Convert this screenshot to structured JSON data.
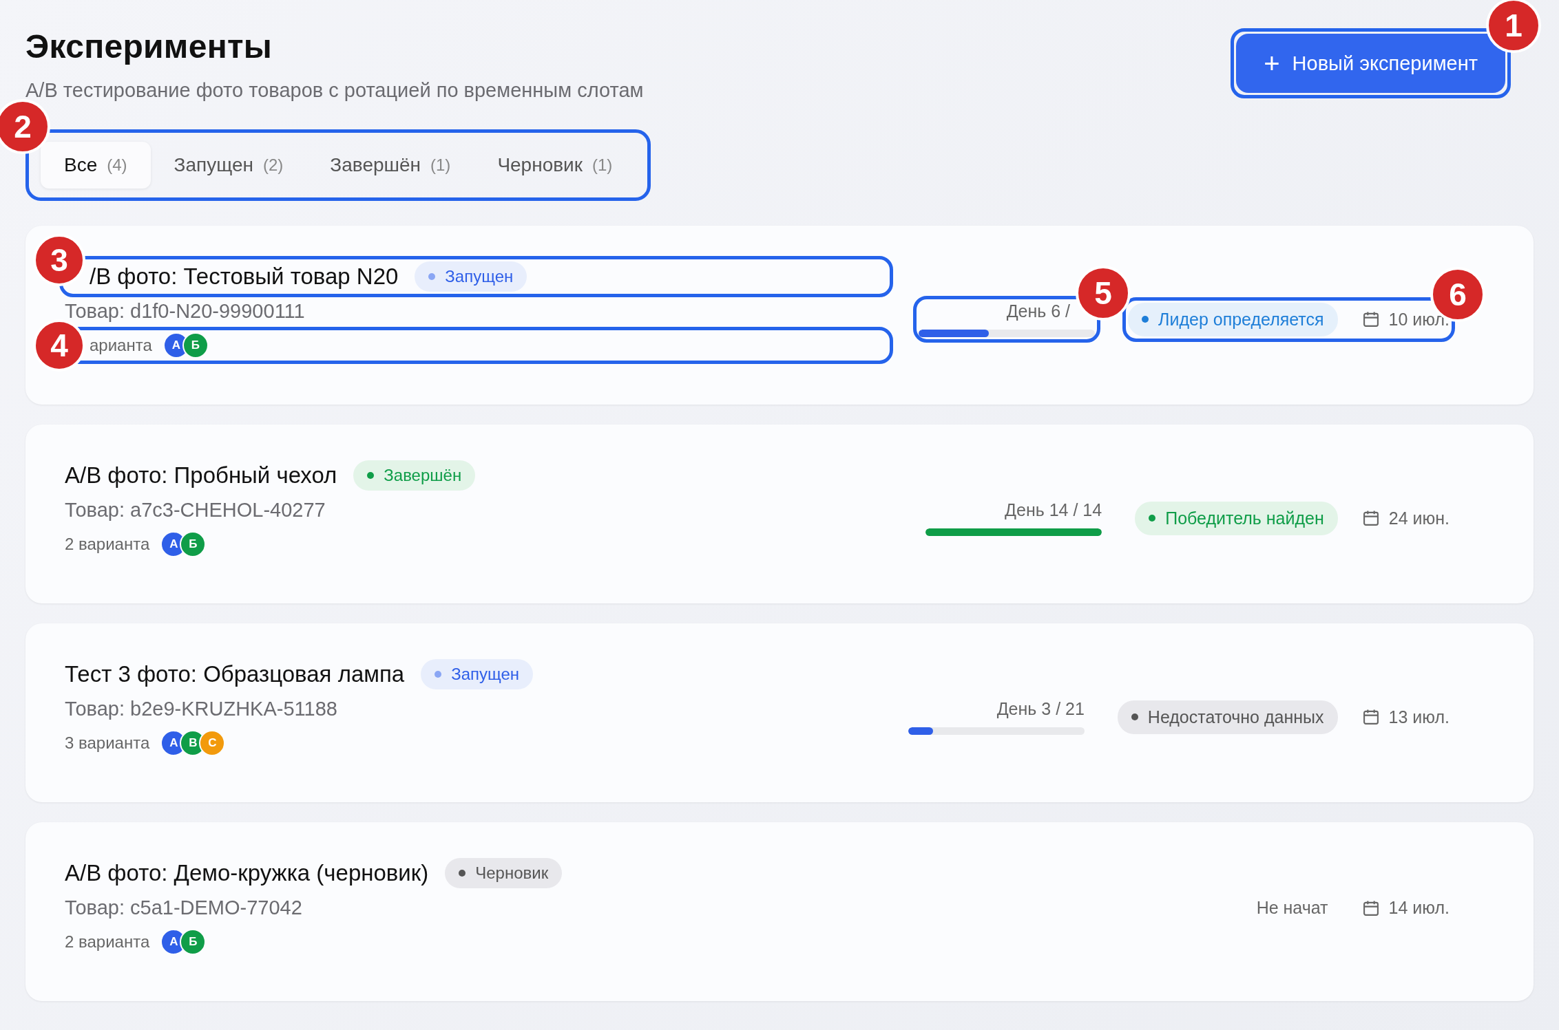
{
  "header": {
    "title": "Эксперименты",
    "subtitle": "A/B тестирование фото товаров с ротацией по временным слотам",
    "new_button": {
      "icon": "+",
      "label": "Новый эксперимент",
      "marker": "1"
    }
  },
  "tabs_marker": "2",
  "tabs": [
    {
      "label": "Все",
      "count": "(4)",
      "selected": true
    },
    {
      "label": "Запущен",
      "count": "(2)",
      "selected": false
    },
    {
      "label": "Завершён",
      "count": "(1)",
      "selected": false
    },
    {
      "label": "Черновик",
      "count": "(1)",
      "selected": false
    }
  ],
  "experiments": [
    {
      "title": "/B фото: Тестовый товар N20",
      "title_marker": "3",
      "status": {
        "kind": "running",
        "label": "Запущен"
      },
      "product": "Товар: d1f0-N20-99900111",
      "variants_label": "арианта",
      "variants_marker": "4",
      "variants": [
        {
          "letter": "А",
          "color": "#2f5fe8"
        },
        {
          "letter": "Б",
          "color": "#0f9d48"
        }
      ],
      "progress": {
        "kind": "bar",
        "day": "День 6 /",
        "level": 0.4,
        "color": "#2f5fe8"
      },
      "progress_marker": "5",
      "result": {
        "kind": "leader",
        "label": "Лидер определяется"
      },
      "result_marker": "6",
      "date": "10 июл."
    },
    {
      "title": "A/B фото: Пробный чехол",
      "status": {
        "kind": "done",
        "label": "Завершён"
      },
      "product": "Товар: a7c3-CHEHOL-40277",
      "variants_label": "2 варианта",
      "variants": [
        {
          "letter": "А",
          "color": "#2f5fe8"
        },
        {
          "letter": "Б",
          "color": "#0f9d48"
        }
      ],
      "progress": {
        "kind": "bar",
        "day": "День 14 / 14",
        "level": 1,
        "color": "#0f9d48"
      },
      "result": {
        "kind": "winner",
        "label": "Победитель найден"
      },
      "date": "24 июн."
    },
    {
      "title": "Тест 3 фото: Образцовая лампа",
      "status": {
        "kind": "running",
        "label": "Запущен"
      },
      "product": "Товар: b2e9-KRUZHKA-51188",
      "variants_label": "3 варианта",
      "variants": [
        {
          "letter": "А",
          "color": "#2f5fe8"
        },
        {
          "letter": "В",
          "color": "#0f9d48"
        },
        {
          "letter": "С",
          "color": "#f29a0c"
        }
      ],
      "progress": {
        "kind": "bar",
        "day": "День 3 / 21",
        "level": 0.14,
        "color": "#2f5fe8"
      },
      "result": {
        "kind": "insufficient",
        "label": "Недостаточно данных"
      },
      "date": "13 июл."
    },
    {
      "title": "A/B фото: Демо-кружка (черновик)",
      "status": {
        "kind": "draft",
        "label": "Черновик"
      },
      "product": "Товар: c5a1-DEMO-77042",
      "variants_label": "2 варианта",
      "variants": [
        {
          "letter": "А",
          "color": "#2f5fe8"
        },
        {
          "letter": "Б",
          "color": "#0f9d48"
        }
      ],
      "progress": {
        "kind": "text",
        "label": "Не начат"
      },
      "date": "14 июл."
    }
  ]
}
